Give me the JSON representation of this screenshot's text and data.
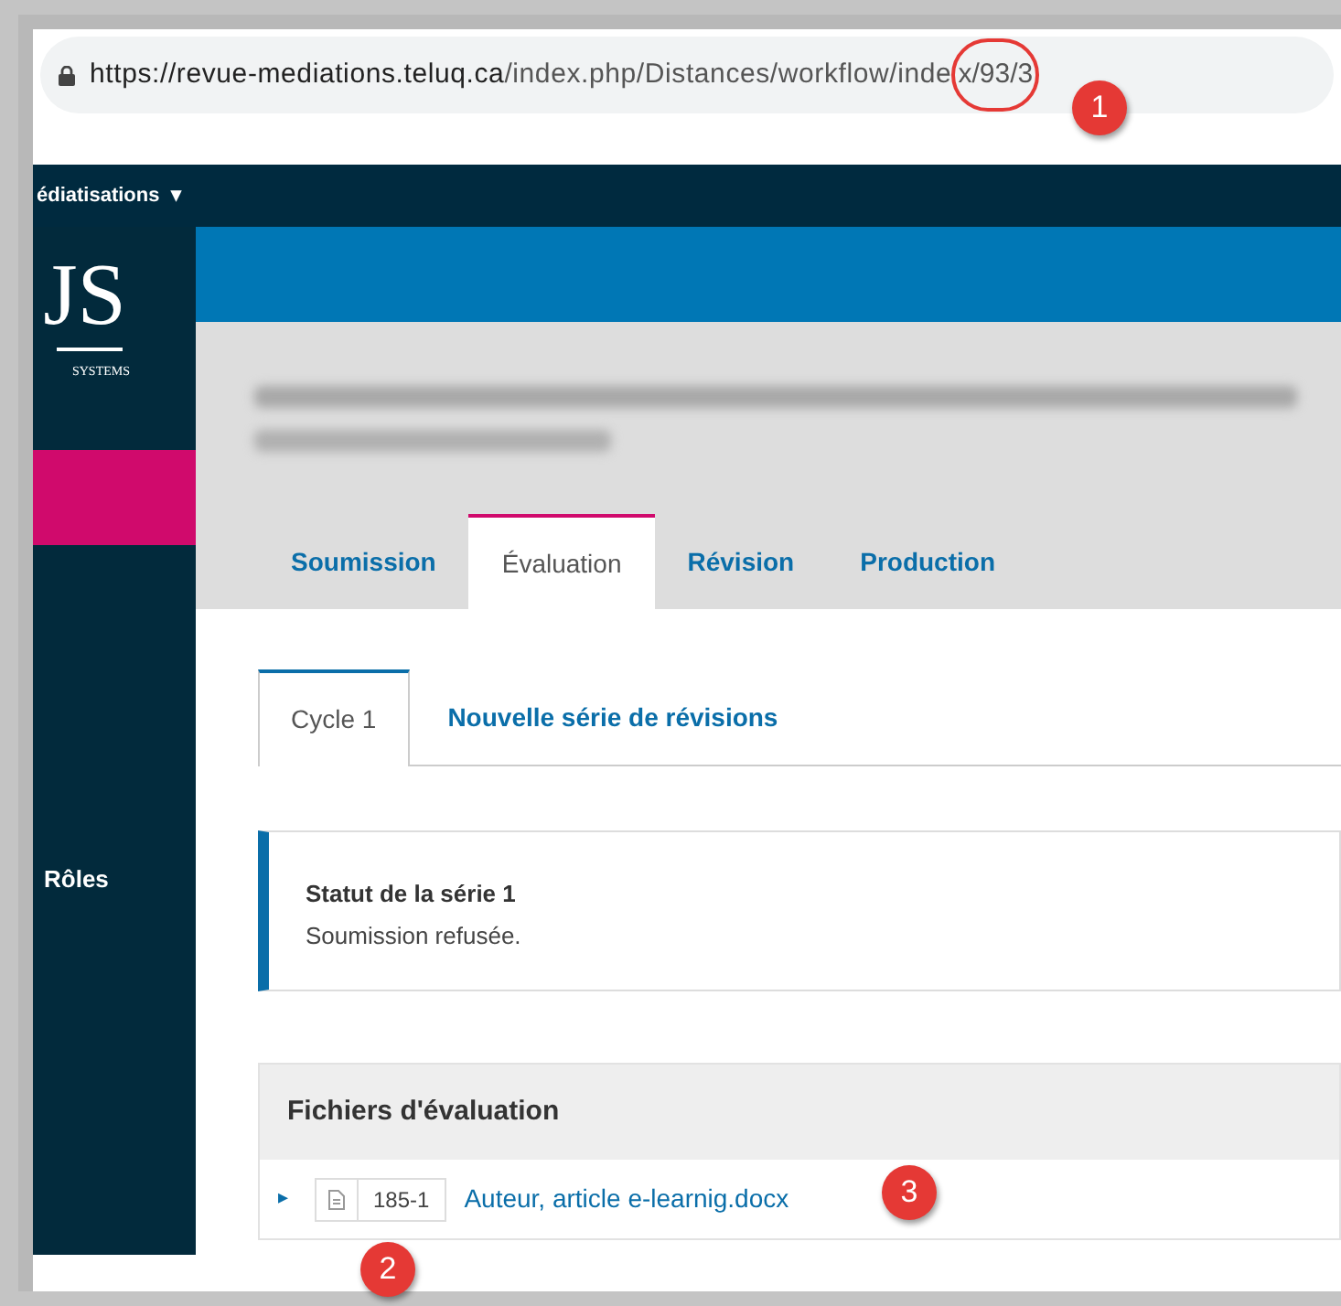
{
  "browser": {
    "url_host": "https://revue-mediations.teluq.ca",
    "url_path": "/index.php/Distances/workflow/inde",
    "url_circled": "x/93/3"
  },
  "header": {
    "journal_menu": "édiatisations",
    "caret": "▾"
  },
  "sidebar": {
    "logo_text": "JS",
    "logo_subtitle": "SYSTEMS",
    "items": [
      {
        "label": "Rôles"
      }
    ]
  },
  "stage_tabs": [
    {
      "label": "Soumission",
      "selected": false
    },
    {
      "label": "Évaluation",
      "selected": true
    },
    {
      "label": "Révision",
      "selected": false
    },
    {
      "label": "Production",
      "selected": false
    }
  ],
  "round_tabs": [
    {
      "label": "Cycle 1",
      "selected": true
    },
    {
      "label": "Nouvelle série de révisions",
      "selected": false
    }
  ],
  "status": {
    "title": "Statut de la série 1",
    "text": "Soumission refusée."
  },
  "files": {
    "title": "Fichiers d'évaluation",
    "rows": [
      {
        "expander": "▸",
        "id": "185-1",
        "name": "Auteur, article e-learnig.docx"
      }
    ]
  },
  "annotations": [
    {
      "label": "1"
    },
    {
      "label": "2"
    },
    {
      "label": "3"
    }
  ]
}
